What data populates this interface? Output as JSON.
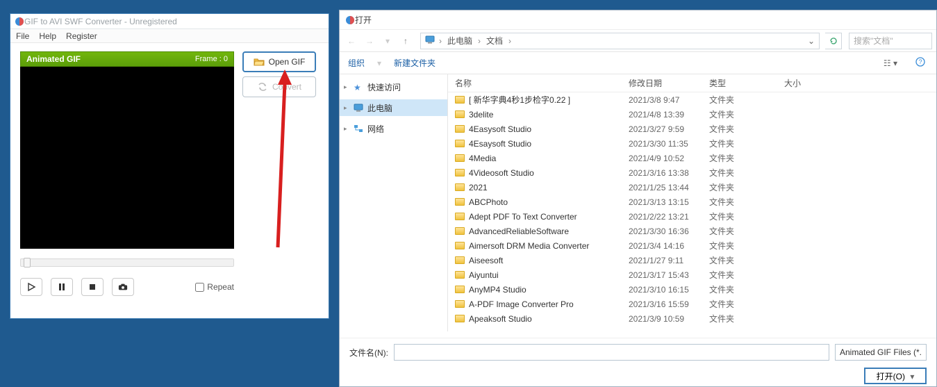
{
  "converter": {
    "title": "GIF to AVI SWF Converter - Unregistered",
    "menu": {
      "file": "File",
      "help": "Help",
      "register": "Register"
    },
    "gif_header": "Animated GIF",
    "frame_label": "Frame : 0",
    "repeat_label": "Repeat",
    "open_gif": "Open GIF",
    "convert": "Convert"
  },
  "open_dialog": {
    "title": "打开",
    "breadcrumb": {
      "root": "此电脑",
      "folder": "文档"
    },
    "search_placeholder": "搜索\"文档\"",
    "toolbar": {
      "organize": "组织",
      "newfolder": "新建文件夹"
    },
    "sidebar": {
      "quick": "快速访问",
      "thispc": "此电脑",
      "network": "网络"
    },
    "columns": {
      "name": "名称",
      "date": "修改日期",
      "type": "类型",
      "size": "大小"
    },
    "folder_type": "文件夹",
    "files": [
      {
        "name": "[ 新华字典4秒1步检字0.22 ]",
        "date": "2021/3/8 9:47"
      },
      {
        "name": "3delite",
        "date": "2021/4/8 13:39"
      },
      {
        "name": "4Easysoft Studio",
        "date": "2021/3/27 9:59"
      },
      {
        "name": "4Esaysoft Studio",
        "date": "2021/3/30 11:35"
      },
      {
        "name": "4Media",
        "date": "2021/4/9 10:52"
      },
      {
        "name": "4Videosoft Studio",
        "date": "2021/3/16 13:38"
      },
      {
        "name": "2021",
        "date": "2021/1/25 13:44"
      },
      {
        "name": "ABCPhoto",
        "date": "2021/3/13 13:15"
      },
      {
        "name": "Adept PDF To Text Converter",
        "date": "2021/2/22 13:21"
      },
      {
        "name": "AdvancedReliableSoftware",
        "date": "2021/3/30 16:36"
      },
      {
        "name": "Aimersoft DRM Media Converter",
        "date": "2021/3/4 14:16"
      },
      {
        "name": "Aiseesoft",
        "date": "2021/1/27 9:11"
      },
      {
        "name": "Aiyuntui",
        "date": "2021/3/17 15:43"
      },
      {
        "name": "AnyMP4 Studio",
        "date": "2021/3/10 16:15"
      },
      {
        "name": "A-PDF Image Converter Pro",
        "date": "2021/3/16 15:59"
      },
      {
        "name": "Apeaksoft Studio",
        "date": "2021/3/9 10:59"
      }
    ],
    "filename_label": "文件名(N):",
    "filter": "Animated GIF Files (*.",
    "open_btn": "打开(O)"
  }
}
